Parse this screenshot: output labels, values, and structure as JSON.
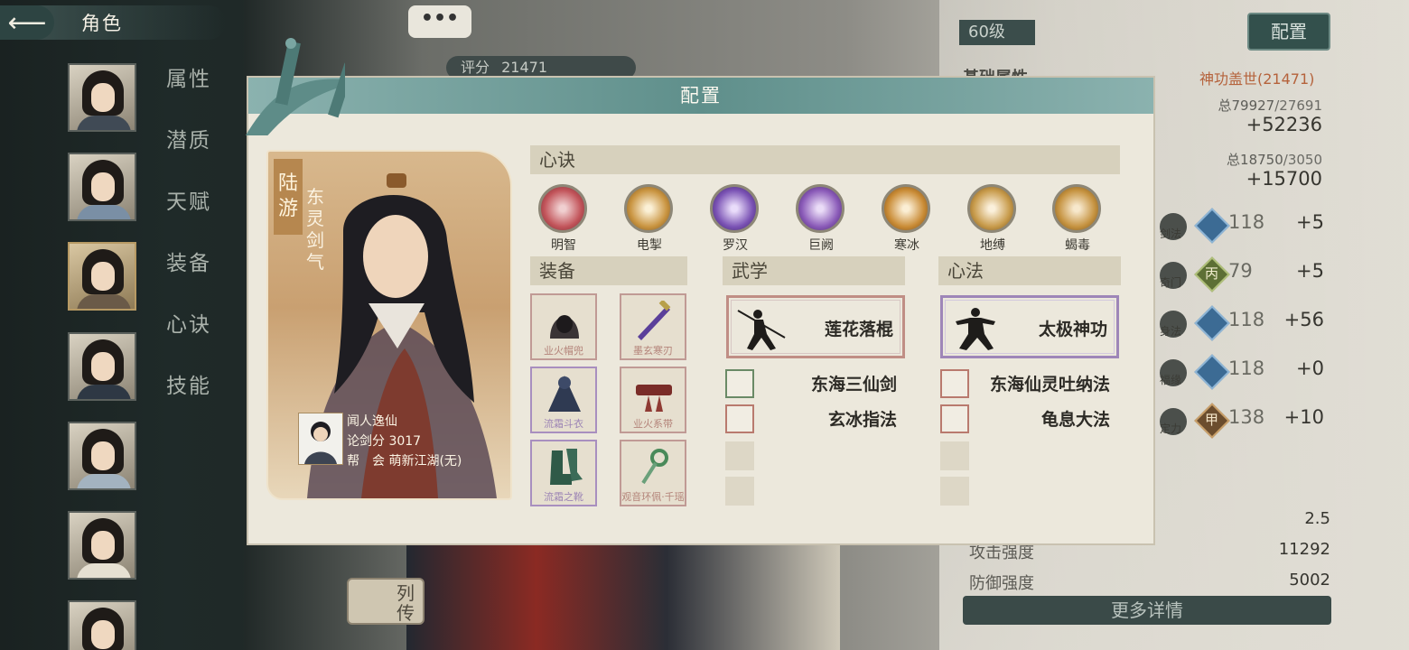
{
  "nav": {
    "back_icon": "left-arrow-icon",
    "title": "角色"
  },
  "tabs": [
    "属性",
    "潜质",
    "天赋",
    "装备",
    "心诀",
    "技能"
  ],
  "top_overlay": {
    "chat_icon": "•••",
    "score_label": "评分",
    "score_value": "21471"
  },
  "liezhuan": "列传",
  "right_panel": {
    "level": "60级",
    "config_button": "配置",
    "base_attr_title": "基础属性",
    "power_title": "神功盖世(21471)",
    "stat1_total_label": "总",
    "stat1_total": "79927",
    "stat1_total_sub": "/27691",
    "stat1_plus": "+52236",
    "stat2_total_label": "总",
    "stat2_total": "18750",
    "stat2_total_sub": "/3050",
    "stat2_plus": "+15700",
    "skills": [
      {
        "label": "剑法",
        "value": "118",
        "bonus": "+5",
        "badge": ""
      },
      {
        "label": "奇门",
        "value": "79",
        "bonus": "+5",
        "badge": "丙"
      },
      {
        "label": "身法",
        "value": "118",
        "bonus": "+56",
        "badge": ""
      },
      {
        "label": "福缘",
        "value": "118",
        "bonus": "+0",
        "badge": ""
      },
      {
        "label": "定力",
        "value": "138",
        "bonus": "+10",
        "badge": "甲"
      }
    ],
    "bottom_stats": [
      {
        "label": "",
        "value": "2.5"
      },
      {
        "label": "攻击强度",
        "value": "11292"
      },
      {
        "label": "防御强度",
        "value": "5002"
      }
    ],
    "more_details": "更多详情"
  },
  "modal": {
    "title": "配置",
    "character": {
      "surname_name": "陆游",
      "style": "东灵剑气",
      "player_name": "闻人逸仙",
      "lunjian_label": "论剑分",
      "lunjian_value": "3017",
      "guild_label": "帮　会",
      "guild_value": "萌新江湖(无)"
    },
    "xinjue_title": "心诀",
    "xinjue": [
      {
        "name": "明智",
        "color": "#c2545a",
        "icon": "mingzhi-orb-icon"
      },
      {
        "name": "电掣",
        "color": "#c99440",
        "icon": "dianche-orb-icon"
      },
      {
        "name": "罗汉",
        "color": "#7a52b4",
        "icon": "luohan-orb-icon"
      },
      {
        "name": "巨阙",
        "color": "#8a5ab8",
        "icon": "jujue-orb-icon"
      },
      {
        "name": "寒冰",
        "color": "#c98b35",
        "icon": "hanbing-orb-icon"
      },
      {
        "name": "地缚",
        "color": "#c79a4a",
        "icon": "difu-orb-icon"
      },
      {
        "name": "蝎毒",
        "color": "#c5923f",
        "icon": "xiedu-orb-icon"
      }
    ],
    "equip_title": "装备",
    "equipment": [
      {
        "name": "业火帽兜",
        "rarity": "red",
        "icon": "hood-icon"
      },
      {
        "name": "墨玄寒刃",
        "rarity": "red",
        "icon": "sword-icon"
      },
      {
        "name": "流霜斗衣",
        "rarity": "purple",
        "icon": "cloak-icon"
      },
      {
        "name": "业火系带",
        "rarity": "red",
        "icon": "belt-icon"
      },
      {
        "name": "流霜之靴",
        "rarity": "purple",
        "icon": "boots-icon"
      },
      {
        "name": "观音环佩·千瑶",
        "rarity": "red",
        "icon": "pendant-icon"
      }
    ],
    "wuxue_title": "武学",
    "wuxue_main": "莲花落棍",
    "wuxue_list": [
      "东海三仙剑",
      "玄冰指法"
    ],
    "xinfa_title": "心法",
    "xinfa_main": "太极神功",
    "xinfa_list": [
      "东海仙灵吐纳法",
      "龟息大法"
    ]
  }
}
